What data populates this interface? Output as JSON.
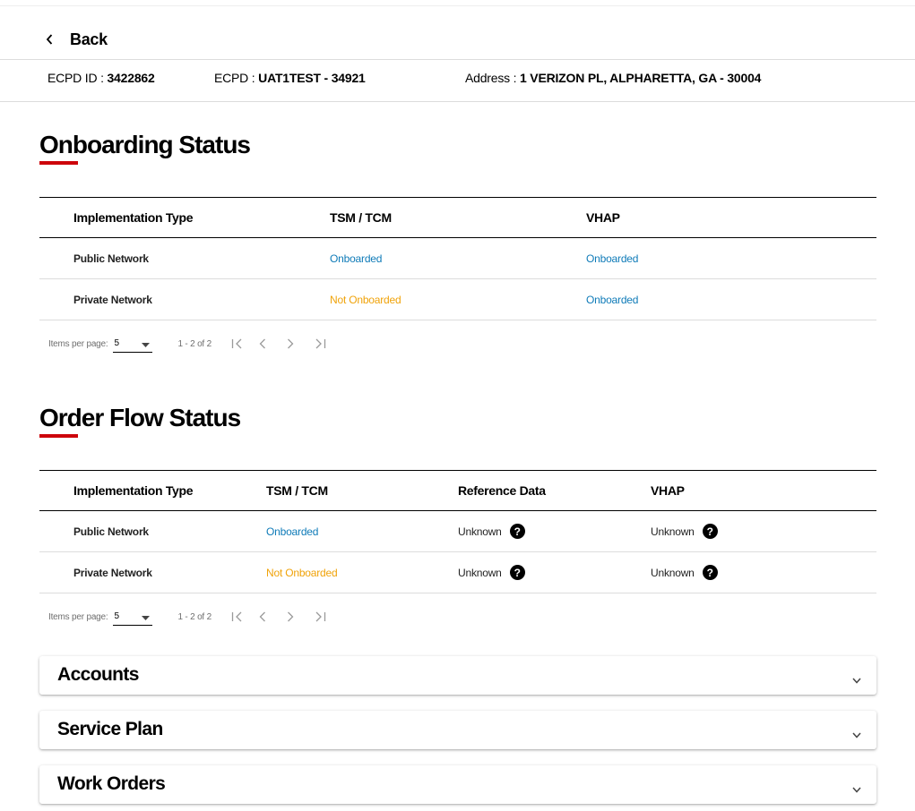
{
  "nav": {
    "back_label": "Back"
  },
  "info": {
    "ecpd_id_label": "ECPD ID : ",
    "ecpd_id_value": "3422862",
    "ecpd_label": "ECPD : ",
    "ecpd_value": "UAT1TEST - 34921",
    "address_label": "Address : ",
    "address_value": "1 VERIZON PL, ALPHARETTA, GA - 30004"
  },
  "onboarding": {
    "title": "Onboarding Status",
    "columns": [
      "Implementation Type",
      "TSM / TCM",
      "VHAP"
    ],
    "rows": [
      {
        "type": "Public Network",
        "tsm": "Onboarded",
        "vhap": "Onboarded"
      },
      {
        "type": "Private Network",
        "tsm": "Not Onboarded",
        "vhap": "Onboarded"
      }
    ],
    "pager": {
      "items_label": "Items per page:",
      "page_size": "5",
      "range": "1 - 2 of 2"
    }
  },
  "order_flow": {
    "title": "Order Flow Status",
    "columns": [
      "Implementation Type",
      "TSM / TCM",
      "Reference Data",
      "VHAP"
    ],
    "rows": [
      {
        "type": "Public Network",
        "tsm": "Onboarded",
        "ref": "Unknown",
        "vhap": "Unknown"
      },
      {
        "type": "Private Network",
        "tsm": "Not Onboarded",
        "ref": "Unknown",
        "vhap": "Unknown"
      }
    ],
    "pager": {
      "items_label": "Items per page:",
      "page_size": "5",
      "range": "1 - 2 of 2"
    }
  },
  "accordions": [
    {
      "title": "Accounts"
    },
    {
      "title": "Service Plan"
    },
    {
      "title": "Work Orders"
    }
  ],
  "colors": {
    "accent_red": "#cd040b",
    "status_onboarded": "#0f7bb8",
    "status_not_onboarded": "#f0a30a"
  },
  "icons": {
    "back": "chevron-left-icon",
    "help": "question-circle-icon",
    "caret": "caret-down-icon",
    "first": "first-page-icon",
    "prev": "chevron-left-icon",
    "next": "chevron-right-icon",
    "last": "last-page-icon",
    "expand": "chevron-down-icon"
  }
}
